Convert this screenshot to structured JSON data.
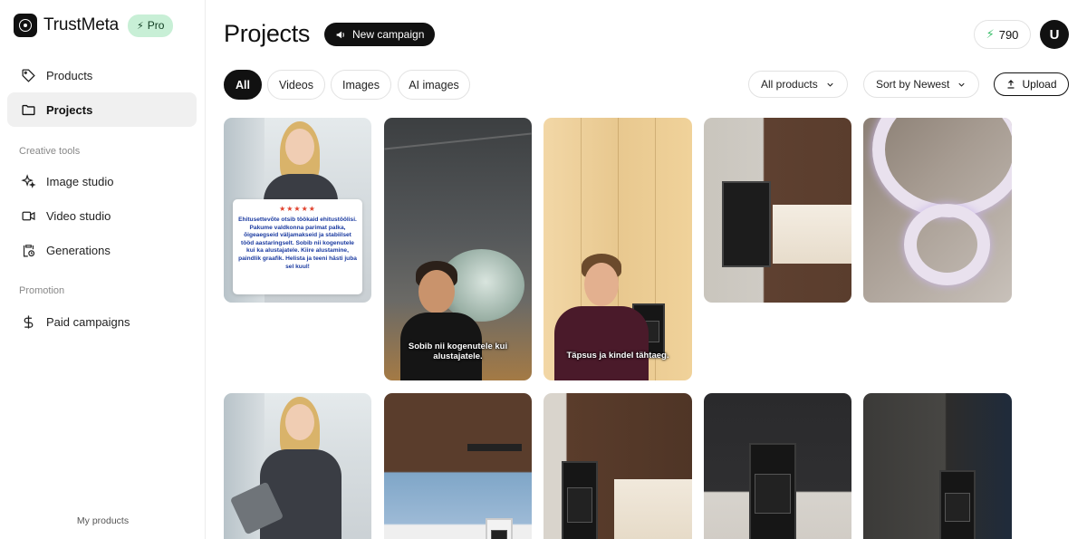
{
  "brand": {
    "name": "TrustMeta",
    "badge": "Pro"
  },
  "sidebar": {
    "items": [
      {
        "label": "Products",
        "icon": "tag-icon"
      },
      {
        "label": "Projects",
        "icon": "folder-icon",
        "active": true
      }
    ],
    "sections": [
      {
        "label": "Creative tools",
        "items": [
          {
            "label": "Image studio",
            "icon": "sparkles-icon"
          },
          {
            "label": "Video studio",
            "icon": "video-camera-icon"
          },
          {
            "label": "Generations",
            "icon": "clipboard-clock-icon"
          }
        ]
      },
      {
        "label": "Promotion",
        "items": [
          {
            "label": "Paid campaigns",
            "icon": "dollar-icon"
          }
        ]
      }
    ],
    "footer": "My products"
  },
  "header": {
    "title": "Projects",
    "new_campaign": "New campaign",
    "credits": "790",
    "avatar_initial": "U"
  },
  "filters": {
    "tabs": [
      "All",
      "Videos",
      "Images",
      "AI images"
    ],
    "active_tab": "All",
    "product_select": "All products",
    "sort_select": "Sort by Newest",
    "upload": "Upload"
  },
  "projects": [
    {
      "kind": "image",
      "overlay": {
        "stars": "★★★★★",
        "text": "Ehitusettevõte otsib töökaid ehitustöölisi. Pakume valdkonna parimat palka, õigeaegseid väljamakseid ja stabiilset tööd aastaringselt. Sobib nii kogenutele kui ka alustajatele. Kiire alustamine, paindlik graafik. Helista ja teeni hästi juba sel kuul!"
      }
    },
    {
      "kind": "video",
      "caption": "Sobib nii kogenutele kui alustajatele."
    },
    {
      "kind": "video",
      "caption": "Täpsus ja kindel tähtaeg."
    },
    {
      "kind": "image"
    },
    {
      "kind": "image"
    },
    {
      "kind": "image"
    },
    {
      "kind": "image"
    },
    {
      "kind": "image"
    },
    {
      "kind": "image"
    },
    {
      "kind": "image"
    }
  ],
  "colors": {
    "accent": "#111111",
    "pro_badge_bg": "#c8efd6",
    "credit_bolt": "#3bbf6b"
  }
}
